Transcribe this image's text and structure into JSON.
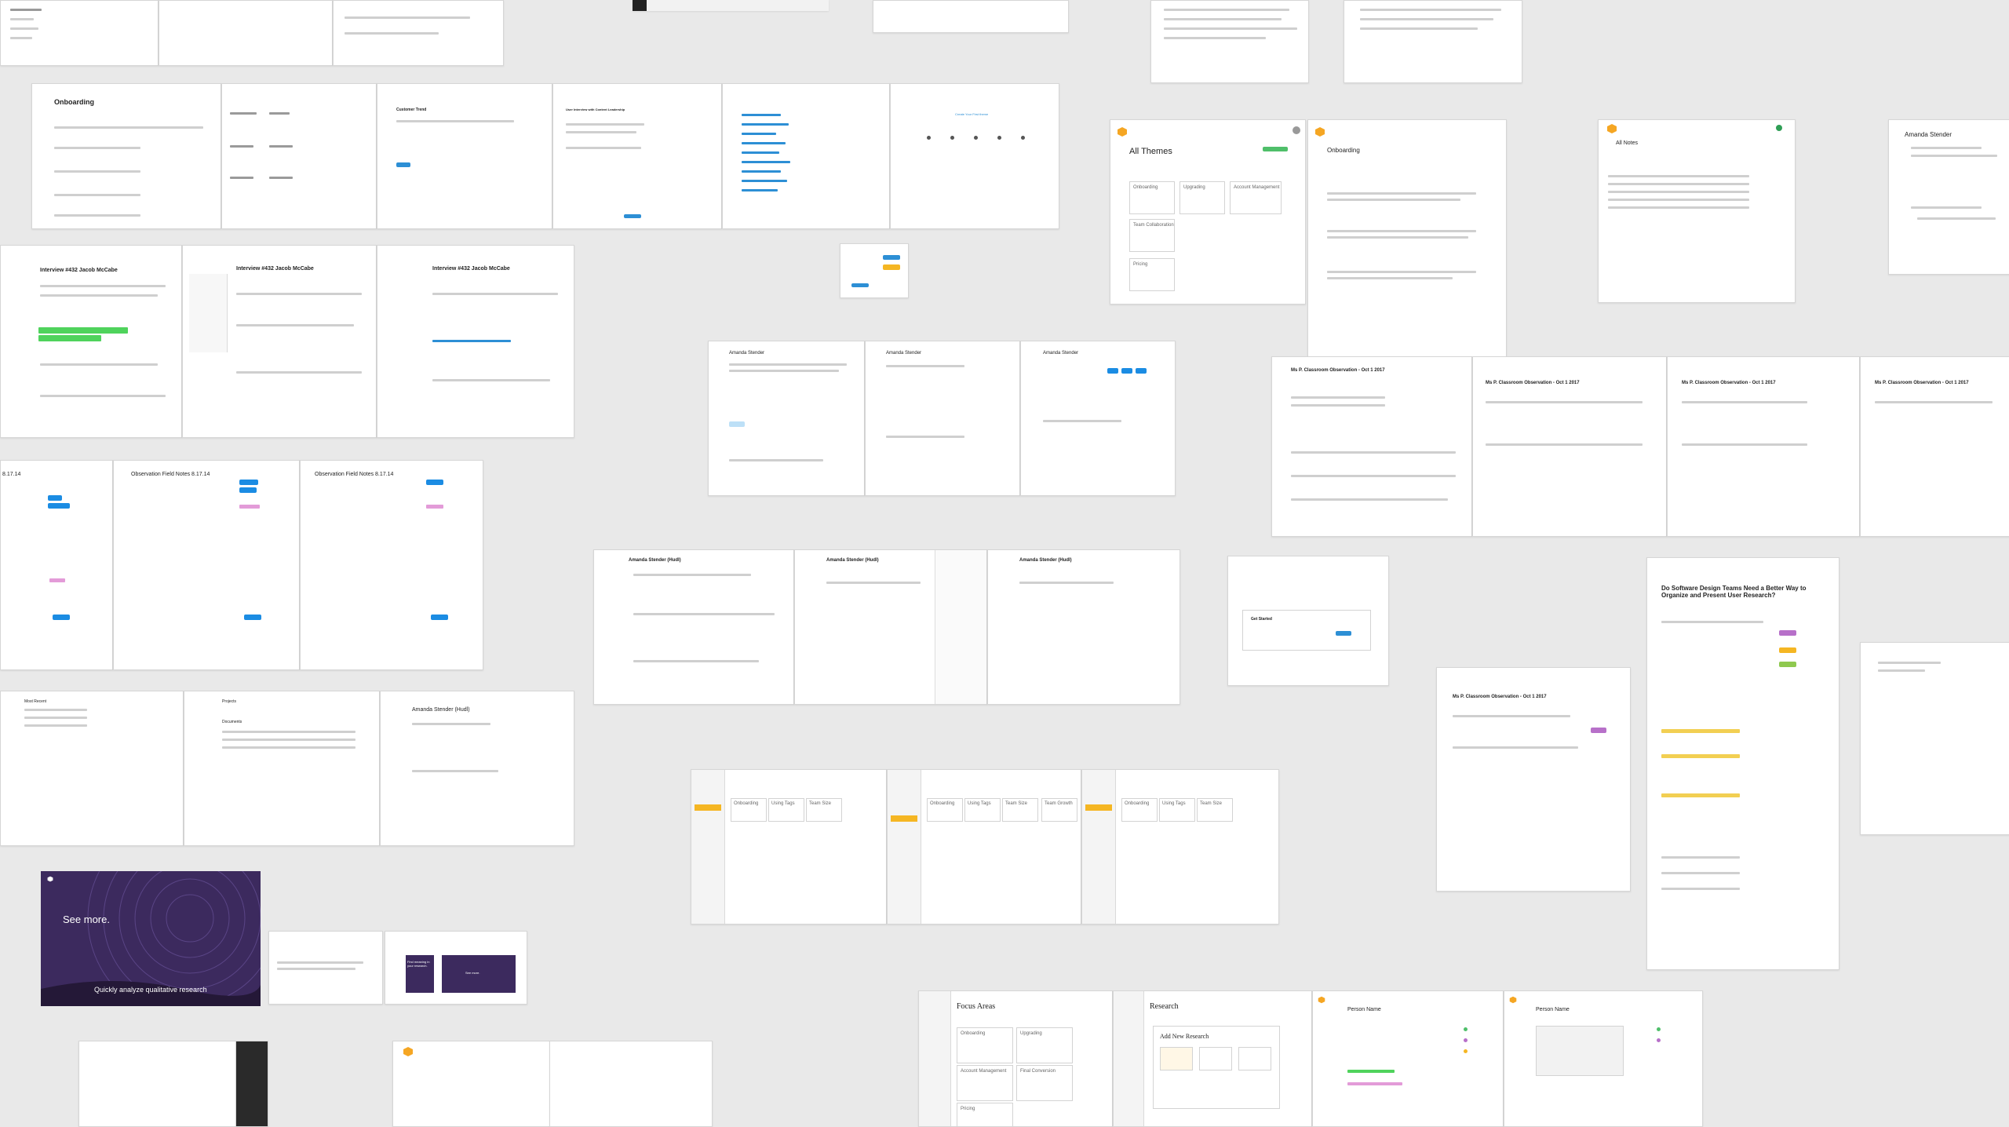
{
  "colors": {
    "background": "#e9e9e9",
    "accent_blue": "#1b8ce3",
    "accent_yellow": "#f5b623",
    "accent_green": "#4fd35c",
    "hero_purple": "#3c2a5e"
  },
  "icons": {
    "app_logo": "hexagon-logo-icon",
    "user": "avatar-icon"
  },
  "frames": {
    "onboarding": {
      "title": "Onboarding"
    },
    "interview": {
      "title": "Interview #432 Jacob McCabe"
    },
    "amanda": {
      "title": "Amanda Stender"
    },
    "amanda_hudl": {
      "title": "Amanda Stender (Hudl)"
    },
    "observation": {
      "title": "Observation Field Notes 8.17.14"
    },
    "observation_short": {
      "title": "8.17.14"
    },
    "classroom": {
      "title": "Ms P. Classroom Observation - Oct 1 2017"
    },
    "all_themes": {
      "title": "All Themes"
    },
    "all_notes": {
      "title": "All Notes"
    },
    "customer_trend": {
      "title": "Customer Trend"
    },
    "user_interview": {
      "title": "User Interview with Content Leadership"
    },
    "create_first_theme": {
      "title": "Create Your First theme"
    },
    "article": {
      "title": "Do Software Design Teams Need a Better Way to Organize and Present User Research?"
    },
    "focus_areas": {
      "title": "Focus Areas"
    },
    "research": {
      "title": "Research"
    },
    "add_new_research": {
      "title": "Add New Research"
    },
    "person_name": {
      "title": "Person Name"
    },
    "get_started": {
      "title": "Get Started"
    },
    "most_recent": {
      "title": "Most Recent"
    },
    "projects": {
      "title": "Projects"
    },
    "documents": {
      "title": "Documents"
    }
  },
  "hero": {
    "headline": "See more.",
    "subheadline": "Quickly analyze qualitative research"
  },
  "cards": {
    "onboarding": "Onboarding",
    "upgrading": "Upgrading",
    "account_management": "Account Management",
    "team_collaboration": "Team Collaboration",
    "pricing": "Pricing",
    "using_tags": "Using Tags",
    "team_size": "Team Size",
    "team_growth": "Team Growth",
    "final_conversion": "Final Conversion"
  },
  "promo": {
    "text": "Find meaning in your research.",
    "see_more": "See more."
  }
}
